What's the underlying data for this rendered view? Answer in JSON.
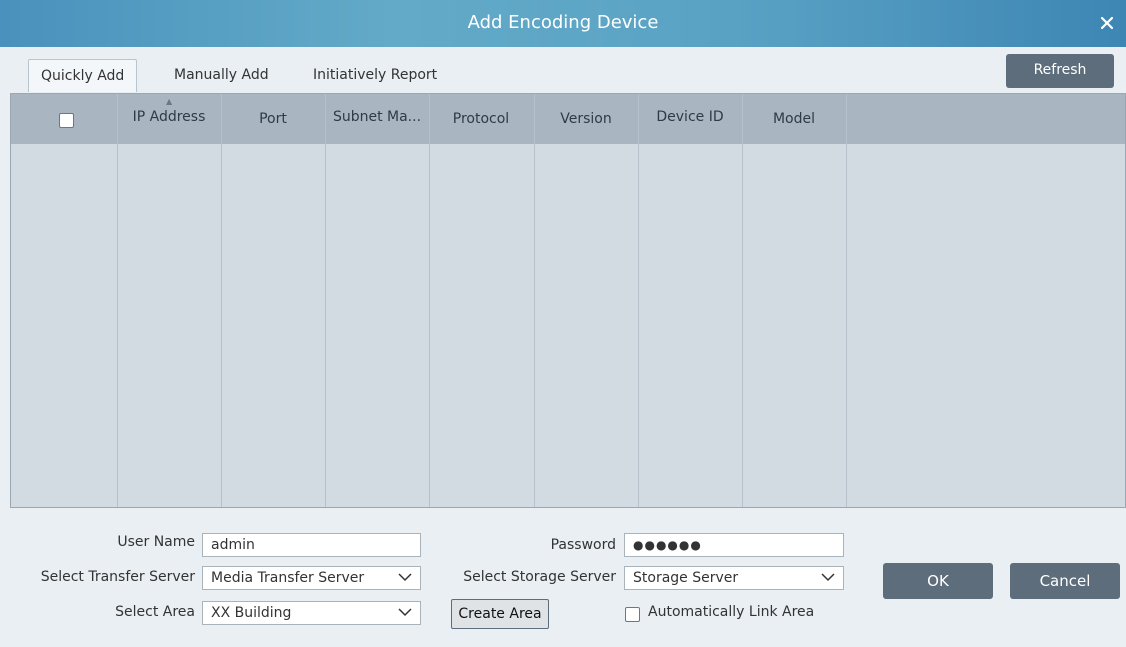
{
  "window": {
    "title": "Add Encoding Device",
    "close_glyph": "✕"
  },
  "tabs": [
    {
      "label": "Quickly Add",
      "active": true
    },
    {
      "label": "Manually Add",
      "active": false
    },
    {
      "label": "Initiatively Report",
      "active": false
    }
  ],
  "toolbar": {
    "refresh_label": "Refresh"
  },
  "table": {
    "columns": [
      "IP Address",
      "Port",
      "Subnet Ma...",
      "Protocol",
      "Version",
      "Device ID",
      "Model"
    ],
    "rows": []
  },
  "form": {
    "user_name": {
      "label": "User Name",
      "value": "admin"
    },
    "password": {
      "label": "Password",
      "value": "●●●●●●"
    },
    "transfer_server": {
      "label": "Select Transfer Server",
      "value": "Media Transfer Server"
    },
    "storage_server": {
      "label": "Select Storage Server",
      "value": "Storage Server"
    },
    "area": {
      "label": "Select Area",
      "value": "XX Building"
    },
    "create_area_label": "Create Area",
    "auto_link_label": "Automatically Link Area"
  },
  "actions": {
    "ok_label": "OK",
    "cancel_label": "Cancel"
  },
  "colors": {
    "title_bar": "#4a92bd",
    "button": "#5d6d7c",
    "table_header": "#a9b6c1",
    "table_body": "#d3dbe2"
  }
}
